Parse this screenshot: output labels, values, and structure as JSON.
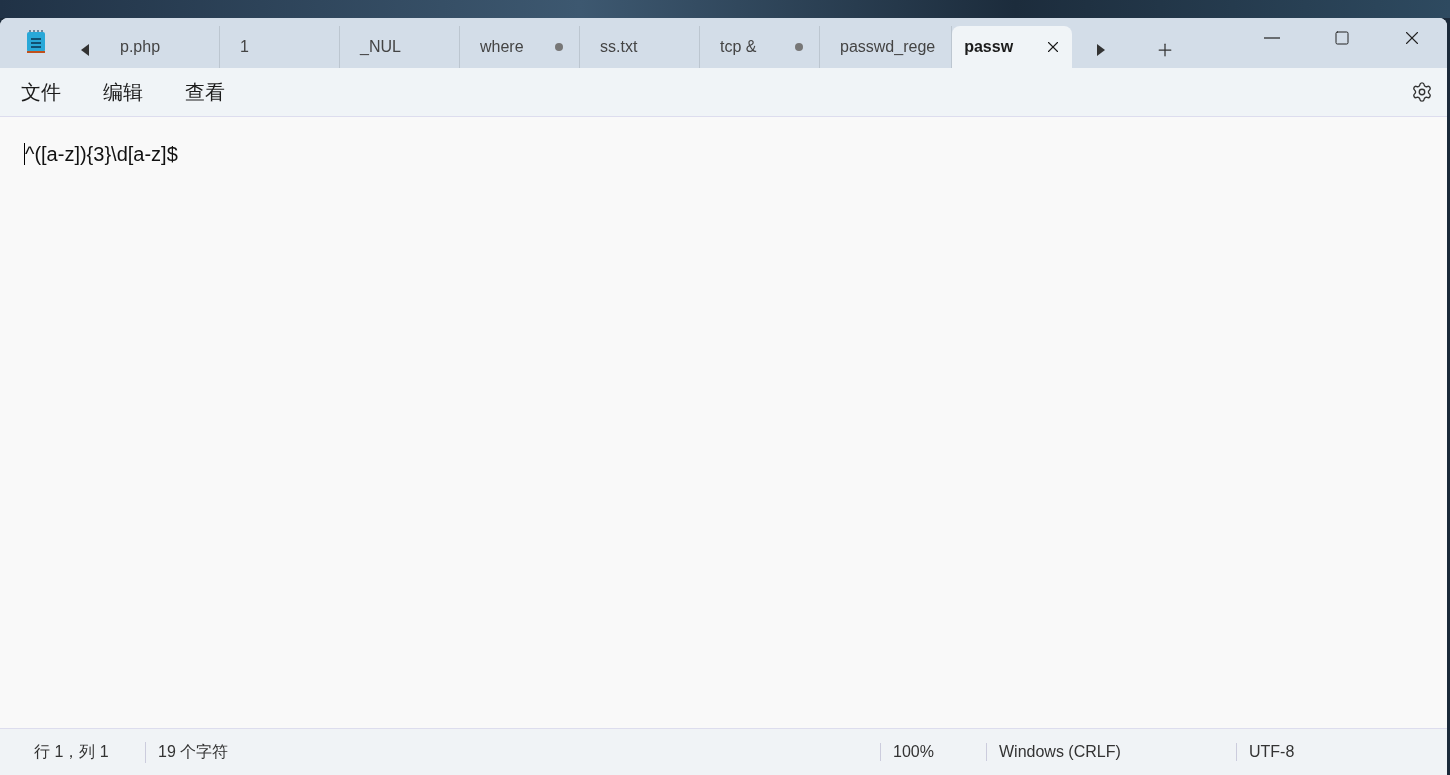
{
  "tabs": [
    {
      "label": "p.php",
      "selected": false,
      "modified": false
    },
    {
      "label": "1",
      "selected": false,
      "modified": false
    },
    {
      "label": "_NUL",
      "selected": false,
      "modified": false
    },
    {
      "label": "where",
      "selected": false,
      "modified": true
    },
    {
      "label": "ss.txt",
      "selected": false,
      "modified": false
    },
    {
      "label": "tcp &",
      "selected": false,
      "modified": true
    },
    {
      "label": "passwd_rege",
      "selected": false,
      "modified": false
    },
    {
      "label": "passw",
      "selected": true,
      "modified": false
    }
  ],
  "menu": [
    "文件",
    "编辑",
    "查看"
  ],
  "editor": {
    "text": "^([a-z]){3}\\d[a-z]$"
  },
  "status_bar": {
    "position": "行 1，列 1",
    "count": "19 个字符",
    "zoom": "100%",
    "line_ending": "Windows (CRLF)",
    "encoding": "UTF-8"
  }
}
